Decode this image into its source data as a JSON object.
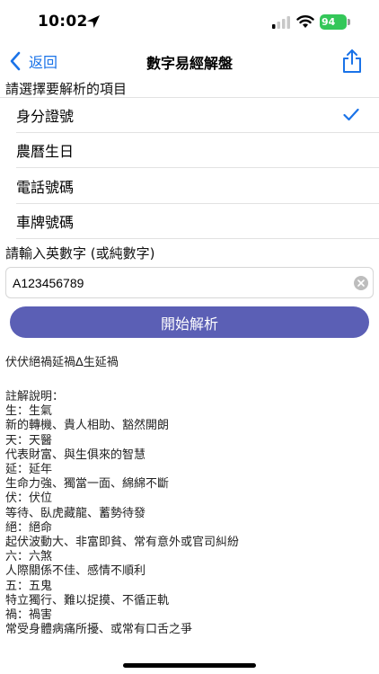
{
  "status": {
    "time": "10:02",
    "battery": "94"
  },
  "nav": {
    "back_label": "返回",
    "title": "數字易經解盤"
  },
  "select_section": {
    "label": "請選擇要解析的項目",
    "options": [
      "身分證號",
      "農曆生日",
      "電話號碼",
      "車牌號碼"
    ],
    "selected": "身分證號"
  },
  "input_section": {
    "label": "請輸入英數字 (或純數字)",
    "value": "A123456789"
  },
  "analyze_button": "開始解析",
  "result": "伏伏絕禍延禍∆生延禍",
  "notes": [
    "註解說明：",
    "生：生氣",
    "新的轉機、貴人相助、豁然開朗",
    "天：天醫",
    "代表財富、與生俱來的智慧",
    "延：延年",
    "生命力強、獨當一面、綿綿不斷",
    "伏：伏位",
    "等待、臥虎藏龍、蓄勢待發",
    "絕：絕命",
    "起伏波動大、非富即貧、常有意外或官司糾紛",
    "六：六煞",
    "人際關係不佳、感情不順利",
    "五：五鬼",
    "特立獨行、難以捉摸、不循正軌",
    "禍：禍害",
    "常受身體病痛所擾、或常有口舌之爭"
  ],
  "colors": {
    "accent": "#1a73e8",
    "button": "#5b5fb5",
    "battery": "#34c759"
  },
  "icons": [
    "location-arrow-icon",
    "cellular-signal-icon",
    "wifi-icon",
    "battery-icon",
    "chevron-left-icon",
    "share-icon",
    "checkmark-icon",
    "clear-icon"
  ]
}
